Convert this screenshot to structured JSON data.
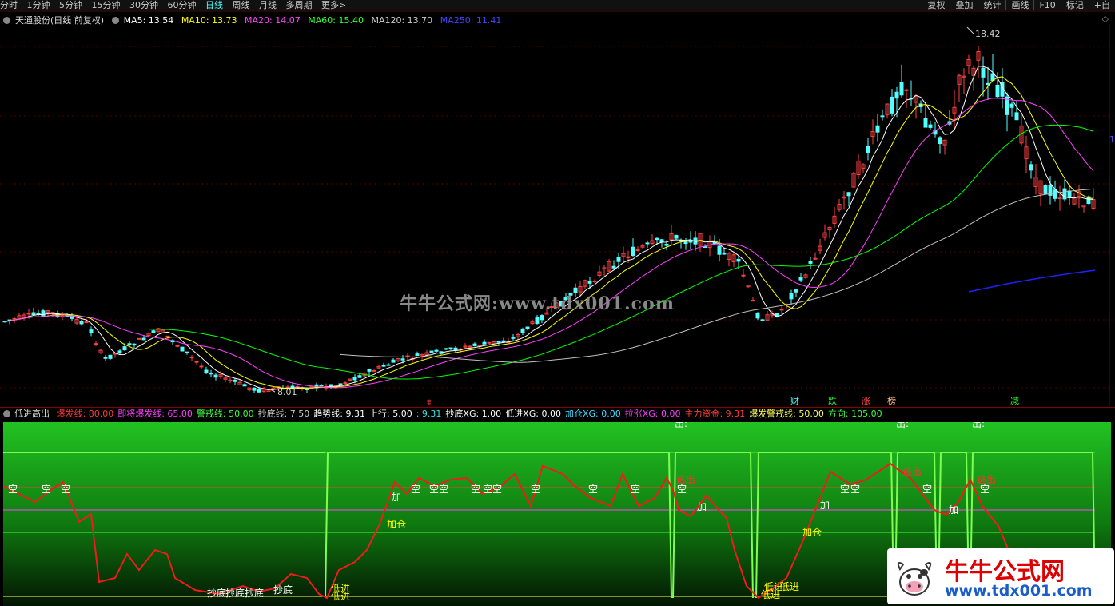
{
  "toolbar": {
    "periods": [
      "分时",
      "1分钟",
      "5分钟",
      "15分钟",
      "30分钟",
      "60分钟",
      "日线",
      "周线",
      "月线",
      "多周期",
      "更多>"
    ],
    "active_period": "日线",
    "actions": [
      "复权",
      "叠加",
      "统计",
      "画线",
      "F10",
      "标记",
      "+自"
    ]
  },
  "main_info": {
    "stock": "天通股份(日线 前复权)",
    "ma5": "MA5: 13.54",
    "ma10": "MA10: 13.73",
    "ma20": "MA20: 14.07",
    "ma60": "MA60: 15.40",
    "ma120": "MA120: 13.70",
    "ma250": "MA250: 11.41"
  },
  "annotations": {
    "high": "18.42",
    "low": "8.01",
    "markers": [
      "财",
      "跌",
      "涨",
      "榜",
      "减"
    ]
  },
  "watermark": "牛牛公式网:www.tdx001.com",
  "sub_info": {
    "name": "低进高出",
    "items": [
      {
        "text": "爆发线: 80.00",
        "color": "#ff3b3b"
      },
      {
        "text": "即将爆发线: 65.00",
        "color": "#ff40ff"
      },
      {
        "text": "警戒线: 50.00",
        "color": "#40ff40"
      },
      {
        "text": "抄底线: 7.50",
        "color": "#c8c8c8"
      },
      {
        "text": "趋势线: 9.31",
        "color": "#ffffff"
      },
      {
        "text": "上行: 5.00",
        "color": "#ffffff"
      },
      {
        "text": ": 9.31",
        "color": "#40e0e0"
      },
      {
        "text": "抄底XG: 1.00",
        "color": "#ffffff"
      },
      {
        "text": "低进XG: 0.00",
        "color": "#ffffff"
      },
      {
        "text": "加仓XG: 0.00",
        "color": "#40e0ff"
      },
      {
        "text": "拉涨XG: 0.00",
        "color": "#ff40ff"
      },
      {
        "text": "主力资金: 9.31",
        "color": "#ff3b3b"
      },
      {
        "text": "爆发警戒线: 50.00",
        "color": "#ffff60"
      },
      {
        "text": "方向: 105.00",
        "color": "#40ff40"
      }
    ]
  },
  "signals": {
    "kong": "空",
    "jia": "加",
    "jiacang": "加仓",
    "chaodi": "抄底",
    "dijin": "低进",
    "chu": "出:",
    "tiaochu": "逃出"
  },
  "logo": {
    "title": "牛牛公式网",
    "url": "www.tdx001.com"
  },
  "right_tag": "1",
  "colors": {
    "up": "#ff4040",
    "down": "#54ffff",
    "ma5": "#ffffff",
    "ma10": "#ffff00",
    "ma20": "#ff40ff",
    "ma60": "#00ff00",
    "ma120": "#c0c0c0",
    "ma250": "#2020ff"
  }
}
